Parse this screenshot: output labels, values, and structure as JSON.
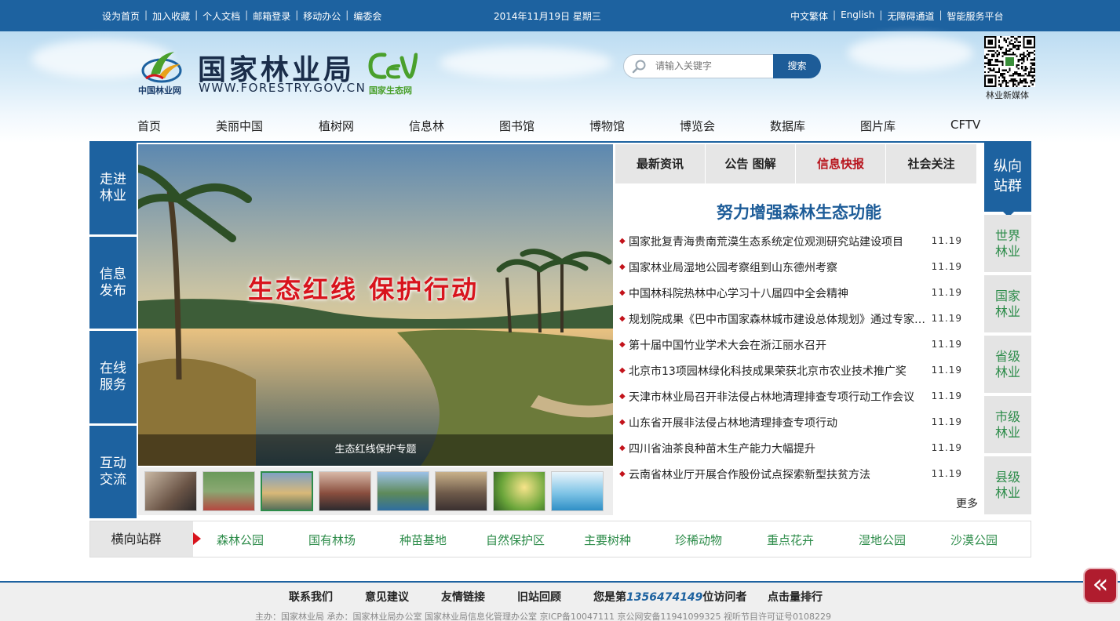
{
  "topbar": {
    "left_links": [
      "设为首页",
      "加入收藏",
      "个人文档",
      "邮箱登录",
      "移动办公",
      "编委会"
    ],
    "date": "2014年11月19日  星期三",
    "right_links": [
      "中文繁体",
      "English",
      "无障碍通道",
      "智能服务平台"
    ]
  },
  "header": {
    "logo_title": "国家林业局",
    "logo_url": "WWW.FORESTRY.GOV.CN",
    "logo_small": "中国林业网",
    "cen_text": "国家生态网",
    "search_placeholder": "请输入关键字",
    "search_button": "搜索",
    "qr_label": "林业新媒体"
  },
  "nav": [
    "首页",
    "美丽中国",
    "植树网",
    "信息林",
    "图书馆",
    "博物馆",
    "博览会",
    "数据库",
    "图片库",
    "CFTV"
  ],
  "left_menu": [
    "走进林业",
    "信息发布",
    "在线服务",
    "互动交流"
  ],
  "slider": {
    "headline": "生态红线  保护行动",
    "caption": "生态红线保护专题"
  },
  "news": {
    "tabs": [
      "最新资讯",
      "公告    图解",
      "信息快报",
      "社会关注"
    ],
    "active_tab": "信息快报",
    "headline": "努力增强森林生态功能",
    "items": [
      {
        "title": "国家批复青海贵南荒漠生态系统定位观测研究站建设项目",
        "date": "11.19"
      },
      {
        "title": "国家林业局湿地公园考察组到山东德州考察",
        "date": "11.19"
      },
      {
        "title": "中国林科院热林中心学习十八届四中全会精神",
        "date": "11.19"
      },
      {
        "title": "规划院成果《巴中市国家森林城市建设总体规划》通过专家评审",
        "date": "11.19"
      },
      {
        "title": "第十届中国竹业学术大会在浙江丽水召开",
        "date": "11.19"
      },
      {
        "title": "北京市13项园林绿化科技成果荣获北京市农业技术推广奖",
        "date": "11.19"
      },
      {
        "title": "天津市林业局召开非法侵占林地清理排查专项行动工作会议",
        "date": "11.19"
      },
      {
        "title": "山东省开展非法侵占林地清理排查专项行动",
        "date": "11.19"
      },
      {
        "title": "四川省油茶良种苗木生产能力大幅提升",
        "date": "11.19"
      },
      {
        "title": "云南省林业厅开展合作股份试点探索新型扶贫方法",
        "date": "11.19"
      }
    ],
    "more": "更多"
  },
  "right_menu": {
    "head": "纵向站群",
    "items": [
      "世界林业",
      "国家林业",
      "省级林业",
      "市级林业",
      "县级林业"
    ]
  },
  "hbar": {
    "head": "横向站群",
    "items": [
      "森林公园",
      "国有林场",
      "种苗基地",
      "自然保护区",
      "主要树种",
      "珍稀动物",
      "重点花卉",
      "湿地公园",
      "沙漠公园"
    ]
  },
  "footer": {
    "contact": "联系我们",
    "feedback": "意见建议",
    "links": "友情链接",
    "old": "旧站回顾",
    "visitor_prefix": "您是第",
    "visitor_count": "1356474149",
    "visitor_suffix": "位访问者",
    "ranking": "点击量排行",
    "small": "主办：国家林业局  承办：国家林业局办公室  国家林业局信息化管理办公室  京ICP备10047111  京公网安备11941099325  视听节目许可证号0108229"
  },
  "colors": {
    "primary_blue": "#1d62a0",
    "accent_red": "#d8141d",
    "accent_green": "#2d8c4a"
  },
  "icons": [
    "search-icon",
    "double-chevron-left-icon",
    "forestry-emblem-icon",
    "cen-logo-icon",
    "qr-code-icon"
  ]
}
